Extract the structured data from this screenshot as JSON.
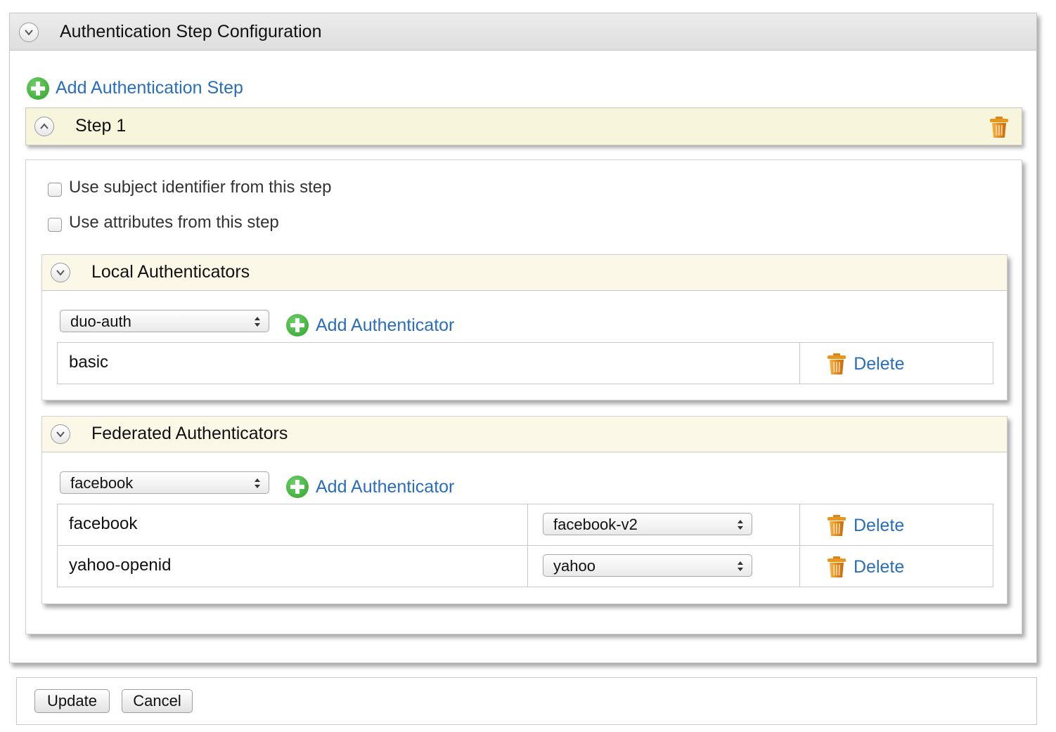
{
  "panel": {
    "title": "Authentication Step Configuration",
    "add_step_label": "Add Authentication Step"
  },
  "step": {
    "title": "Step 1",
    "options": [
      {
        "label": "Use subject identifier from this step",
        "checked": false
      },
      {
        "label": "Use attributes from this step",
        "checked": false
      }
    ]
  },
  "local_authenticators": {
    "title": "Local Authenticators",
    "select_value": "duo-auth",
    "add_label": "Add Authenticator",
    "rows": [
      {
        "name": "basic",
        "delete_label": "Delete"
      }
    ]
  },
  "federated_authenticators": {
    "title": "Federated Authenticators",
    "select_value": "facebook",
    "add_label": "Add Authenticator",
    "rows": [
      {
        "name": "facebook",
        "config": "facebook-v2",
        "delete_label": "Delete"
      },
      {
        "name": "yahoo-openid",
        "config": "yahoo",
        "delete_label": "Delete"
      }
    ]
  },
  "footer": {
    "update_label": "Update",
    "cancel_label": "Cancel"
  },
  "colors": {
    "link": "#2a6ebb",
    "step_header_bg": "#f7f6dc",
    "section_header_bg": "#fcf8e8",
    "add_icon": "#2ea32a",
    "trash_icon": "#e8961e"
  }
}
